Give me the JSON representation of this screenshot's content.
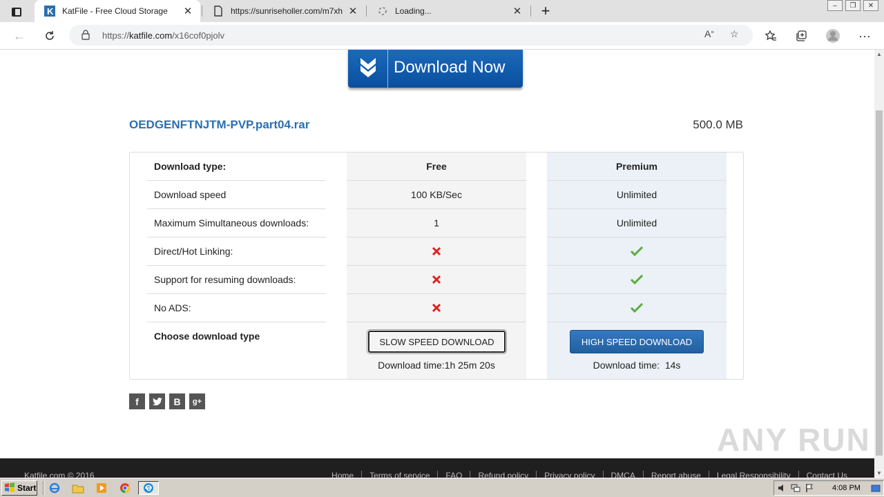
{
  "browser": {
    "tabs": [
      {
        "title": "KatFile - Free Cloud Storage",
        "active": true,
        "favicon": "katfile-k-icon"
      },
      {
        "title": "https://sunriseholler.com/m7xh",
        "active": false,
        "favicon": "page-icon"
      },
      {
        "title": "Loading...",
        "active": false,
        "favicon": "loading-icon"
      }
    ],
    "address": {
      "prefix": "https://",
      "host": "katfile.com",
      "path": "/x16cof0pjolv"
    }
  },
  "page": {
    "download_now_label": "Download Now",
    "file": {
      "name": "OEDGENFTNJTM-PVP.part04.rar",
      "size": "500.0 MB"
    },
    "table": {
      "header": {
        "label": "Download type:",
        "free": "Free",
        "premium": "Premium"
      },
      "rows": [
        {
          "label": "Download speed",
          "free": "100 KB/Sec",
          "premium": "Unlimited"
        },
        {
          "label": "Maximum Simultaneous downloads:",
          "free": "1",
          "premium": "Unlimited"
        },
        {
          "label": "Direct/Hot Linking:",
          "free": "cross-icon",
          "premium": "check-icon"
        },
        {
          "label": "Support for resuming downloads:",
          "free": "cross-icon",
          "premium": "check-icon"
        },
        {
          "label": "No ADS:",
          "free": "cross-icon",
          "premium": "check-icon"
        }
      ],
      "choose_label": "Choose download type",
      "slow_button": "SLOW SPEED DOWNLOAD",
      "fast_button": "HIGH SPEED DOWNLOAD",
      "free_time": "Download time:1h 25m 20s",
      "premium_time": "Download time:  14s"
    },
    "social": [
      "f",
      "t",
      "B",
      "g+"
    ],
    "watermark": "ANY RUN",
    "footer": {
      "copyright": "Katfile.com © 2016",
      "links": [
        "Home",
        "Terms of service",
        "FAQ",
        "Refund policy",
        "Privacy policy",
        "DMCA",
        "Report abuse",
        "Legal Responsibility",
        "Contact Us"
      ]
    }
  },
  "taskbar": {
    "start_label": "Start",
    "clock": "4:08 PM"
  },
  "colors": {
    "link_blue": "#2a6fb0",
    "button_blue": "#225f9f",
    "cross_red": "#e02020",
    "check_green": "#5aac3a"
  }
}
